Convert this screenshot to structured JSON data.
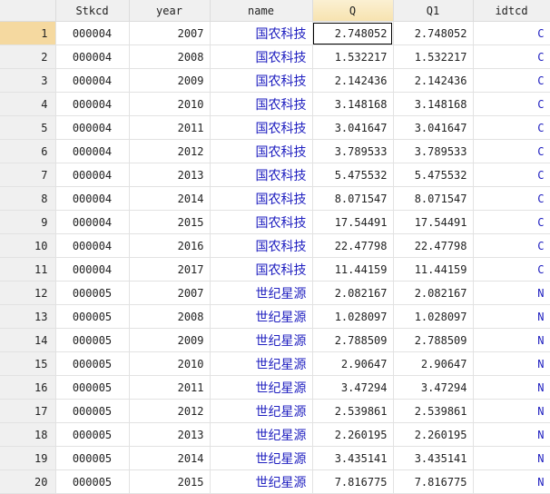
{
  "columns": [
    "",
    "Stkcd",
    "year",
    "name",
    "Q",
    "Q1",
    "idtcd"
  ],
  "rows": [
    [
      "1",
      "000004",
      "2007",
      "国农科技",
      "2.748052",
      "2.748052",
      "C"
    ],
    [
      "2",
      "000004",
      "2008",
      "国农科技",
      "1.532217",
      "1.532217",
      "C"
    ],
    [
      "3",
      "000004",
      "2009",
      "国农科技",
      "2.142436",
      "2.142436",
      "C"
    ],
    [
      "4",
      "000004",
      "2010",
      "国农科技",
      "3.148168",
      "3.148168",
      "C"
    ],
    [
      "5",
      "000004",
      "2011",
      "国农科技",
      "3.041647",
      "3.041647",
      "C"
    ],
    [
      "6",
      "000004",
      "2012",
      "国农科技",
      "3.789533",
      "3.789533",
      "C"
    ],
    [
      "7",
      "000004",
      "2013",
      "国农科技",
      "5.475532",
      "5.475532",
      "C"
    ],
    [
      "8",
      "000004",
      "2014",
      "国农科技",
      "8.071547",
      "8.071547",
      "C"
    ],
    [
      "9",
      "000004",
      "2015",
      "国农科技",
      "17.54491",
      "17.54491",
      "C"
    ],
    [
      "10",
      "000004",
      "2016",
      "国农科技",
      "22.47798",
      "22.47798",
      "C"
    ],
    [
      "11",
      "000004",
      "2017",
      "国农科技",
      "11.44159",
      "11.44159",
      "C"
    ],
    [
      "12",
      "000005",
      "2007",
      "世纪星源",
      "2.082167",
      "2.082167",
      "N"
    ],
    [
      "13",
      "000005",
      "2008",
      "世纪星源",
      "1.028097",
      "1.028097",
      "N"
    ],
    [
      "14",
      "000005",
      "2009",
      "世纪星源",
      "2.788509",
      "2.788509",
      "N"
    ],
    [
      "15",
      "000005",
      "2010",
      "世纪星源",
      "2.90647",
      "2.90647",
      "N"
    ],
    [
      "16",
      "000005",
      "2011",
      "世纪星源",
      "3.47294",
      "3.47294",
      "N"
    ],
    [
      "17",
      "000005",
      "2012",
      "世纪星源",
      "2.539861",
      "2.539861",
      "N"
    ],
    [
      "18",
      "000005",
      "2013",
      "世纪星源",
      "2.260195",
      "2.260195",
      "N"
    ],
    [
      "19",
      "000005",
      "2014",
      "世纪星源",
      "3.435141",
      "3.435141",
      "N"
    ],
    [
      "20",
      "000005",
      "2015",
      "世纪星源",
      "7.816775",
      "7.816775",
      "N"
    ]
  ]
}
